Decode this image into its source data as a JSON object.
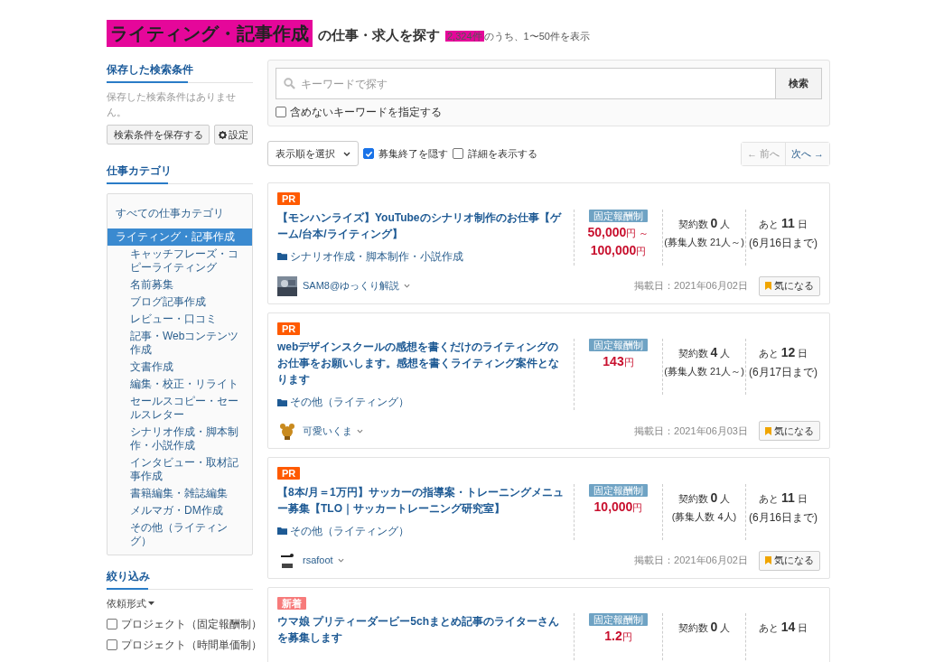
{
  "heading": {
    "category": "ライティング・記事作成",
    "category_highlighted": true,
    "suffix": "の仕事・求人を探す",
    "count": "2,324件",
    "count_highlighted": true,
    "range": "のうち、1〜50件を表示"
  },
  "saved_search": {
    "title": "保存した検索条件",
    "empty": "保存した検索条件はありません。",
    "save_button": "検索条件を保存する",
    "settings_button": "設定"
  },
  "categories": {
    "title": "仕事カテゴリ",
    "all": "すべての仕事カテゴリ",
    "items": [
      {
        "label": "ライティング・記事作成",
        "selected": true,
        "children": [
          {
            "label": "キャッチフレーズ・コピーライティング",
            "selected": false
          },
          {
            "label": "名前募集",
            "selected": false
          },
          {
            "label": "ブログ記事作成",
            "selected": false
          },
          {
            "label": "レビュー・口コミ",
            "selected": false
          },
          {
            "label": "記事・Webコンテンツ作成",
            "selected": false
          },
          {
            "label": "文書作成",
            "selected": false
          },
          {
            "label": "編集・校正・リライト",
            "selected": false
          },
          {
            "label": "セールスコピー・セールスレター",
            "selected": false
          },
          {
            "label": "シナリオ作成・脚本制作・小説作成",
            "selected": false
          },
          {
            "label": "インタビュー・取材記事作成",
            "selected": false
          },
          {
            "label": "書籍編集・雑誌編集",
            "selected": false
          },
          {
            "label": "メルマガ・DM作成",
            "selected": false
          },
          {
            "label": "その他（ライティング）",
            "selected": false
          }
        ]
      }
    ]
  },
  "filter": {
    "title": "絞り込み",
    "group": "依頼形式",
    "options": [
      {
        "label": "プロジェクト（固定報酬制）",
        "checked": false
      },
      {
        "label": "プロジェクト（時間単価制）",
        "checked": false
      }
    ]
  },
  "search": {
    "placeholder": "キーワードで探す",
    "button": "検索",
    "exclude": {
      "label": "含めないキーワードを指定する",
      "checked": false
    }
  },
  "toolbar": {
    "sort": "表示順を選択",
    "hide_closed": {
      "label": "募集終了を隠す",
      "checked": true
    },
    "show_details": {
      "label": "詳細を表示する",
      "checked": false
    },
    "prev": {
      "label": "← 前へ",
      "disabled": true
    },
    "next": {
      "label": "次へ →",
      "disabled": false
    }
  },
  "jobs": [
    {
      "badge": {
        "kind": "pr",
        "text": "PR"
      },
      "title": "【モンハンライズ】YouTubeのシナリオ制作のお仕事【ゲーム/台本/ライティング】",
      "category": "シナリオ作成・脚本制作・小説作成",
      "pay_type": "固定報酬制",
      "price": [
        {
          "amount": "50,000",
          "unit": "円 ～"
        },
        {
          "amount": "100,000",
          "unit": "円"
        }
      ],
      "contracts_label": "契約数",
      "contracts": "0",
      "contracts_unit": "人",
      "recruit": "(募集人数 21人～)",
      "remaining_label": "あと",
      "remaining": "11",
      "remaining_unit": "日",
      "deadline": "(6月16日まで)",
      "client": "SAM8@ゆっくり解説",
      "posted": "掲載日：2021年06月02日",
      "bookmark": "気になる"
    },
    {
      "badge": {
        "kind": "pr",
        "text": "PR"
      },
      "title": "webデザインスクールの感想を書くだけのライティングのお仕事をお願いします。感想を書くライティング案件となります",
      "category": "その他（ライティング）",
      "pay_type": "固定報酬制",
      "price": [
        {
          "amount": "143",
          "unit": "円"
        }
      ],
      "contracts_label": "契約数",
      "contracts": "4",
      "contracts_unit": "人",
      "recruit": "(募集人数 21人～)",
      "remaining_label": "あと",
      "remaining": "12",
      "remaining_unit": "日",
      "deadline": "(6月17日まで)",
      "client": "可愛いくま",
      "posted": "掲載日：2021年06月03日",
      "bookmark": "気になる"
    },
    {
      "badge": {
        "kind": "pr",
        "text": "PR"
      },
      "title": "【8本/月＝1万円】サッカーの指導案・トレーニングメニュー募集【TLO｜サッカートレーニング研究室】",
      "category": "その他（ライティング）",
      "pay_type": "固定報酬制",
      "price": [
        {
          "amount": "10,000",
          "unit": "円"
        }
      ],
      "contracts_label": "契約数",
      "contracts": "0",
      "contracts_unit": "人",
      "recruit": "(募集人数 4人)",
      "remaining_label": "あと",
      "remaining": "11",
      "remaining_unit": "日",
      "deadline": "(6月16日まで)",
      "client": "rsafoot",
      "posted": "掲載日：2021年06月02日",
      "bookmark": "気になる"
    },
    {
      "badge": {
        "kind": "new",
        "text": "新着"
      },
      "title": "ウマ娘 プリティーダービー5chまとめ記事のライターさんを募集します",
      "pay_type": "固定報酬制",
      "price": [
        {
          "amount": "1.2",
          "unit": "円"
        }
      ],
      "contracts_label": "契約数",
      "contracts": "0",
      "contracts_unit": "人",
      "remaining_label": "あと",
      "remaining": "14",
      "remaining_unit": "日"
    }
  ]
}
